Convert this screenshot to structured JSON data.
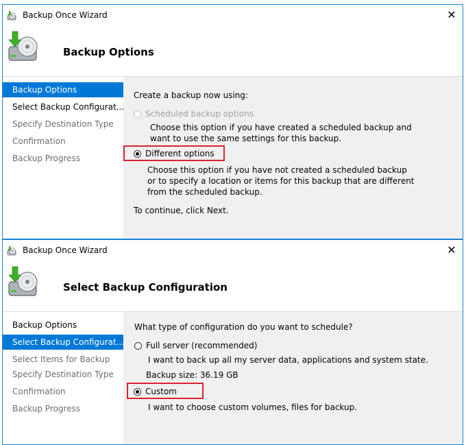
{
  "wizard1": {
    "window_title": "Backup Once Wizard",
    "close_glyph": "✕",
    "header_title": "Backup Options",
    "nav_items": [
      {
        "label": "Backup Options"
      },
      {
        "label": "Select Backup Configurat..."
      },
      {
        "label": "Specify Destination Type"
      },
      {
        "label": "Confirmation"
      },
      {
        "label": "Backup Progress"
      }
    ],
    "prompt": "Create a backup now using:",
    "option_scheduled": {
      "label": "Scheduled backup options",
      "desc_lines": [
        "Choose this option if you have created a scheduled backup and",
        "want to use the same settings for this backup."
      ]
    },
    "option_different": {
      "label": "Different options",
      "desc_lines": [
        "Choose this option if you have not created a scheduled backup",
        "or to specify a location or items for this backup that are different",
        "from the scheduled backup."
      ]
    },
    "continue_text": "To continue, click Next."
  },
  "wizard2": {
    "window_title": "Backup Once Wizard",
    "close_glyph": "✕",
    "header_title": "Select Backup Configuration",
    "nav_items": [
      {
        "label": "Backup Options"
      },
      {
        "label": "Select Backup Configurat..."
      },
      {
        "label": "Select Items for Backup"
      },
      {
        "label": "Specify Destination Type"
      },
      {
        "label": "Confirmation"
      },
      {
        "label": "Backup Progress"
      }
    ],
    "prompt": "What type of configuration do you want to schedule?",
    "option_full": {
      "label": "Full server (recommended)",
      "desc": "I want to back up all my server data, applications and system state.",
      "size_text": "Backup size: 36.19 GB"
    },
    "option_custom": {
      "label": "Custom",
      "desc": "I want to choose custom volumes, files for backup."
    }
  },
  "icons": {
    "app": "backup-disk-icon",
    "header": "backup-disk-arrow-icon",
    "close": "close-icon"
  },
  "colors": {
    "accent": "#0078d7",
    "window_border": "#1883d7",
    "highlight_box": "#d9232d",
    "panel_bg": "#f0f0f0",
    "arrow_green": "#3fae2a"
  }
}
